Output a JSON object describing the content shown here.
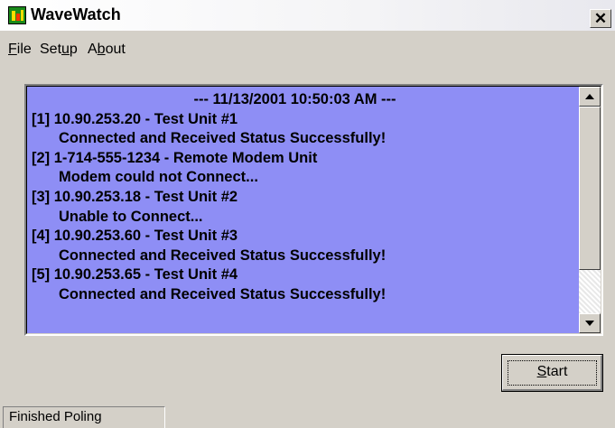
{
  "window": {
    "title": "WaveWatch",
    "icon": "wavewatch-app-icon",
    "close_label": "✕"
  },
  "menu": [
    {
      "label_pre": "",
      "mnemonic": "F",
      "label_post": "ile"
    },
    {
      "label_pre": "Set",
      "mnemonic": "u",
      "label_post": "p"
    },
    {
      "label_pre": "A",
      "mnemonic": "b",
      "label_post": "out"
    }
  ],
  "log": {
    "header": "--- 11/13/2001 10:50:03 AM ---",
    "entries": [
      {
        "unit": "[1] 10.90.253.20 - Test Unit #1",
        "status": "Connected and Received Status Successfully!"
      },
      {
        "unit": "[2] 1-714-555-1234 - Remote Modem Unit",
        "status": "Modem could not Connect..."
      },
      {
        "unit": "[3] 10.90.253.18 - Test Unit #2",
        "status": "Unable to Connect..."
      },
      {
        "unit": "[4] 10.90.253.60 - Test Unit #3",
        "status": "Connected and Received Status Successfully!"
      },
      {
        "unit": "[5] 10.90.253.65 - Test Unit #4",
        "status": "Connected and Received Status Successfully!"
      }
    ],
    "background_color": "#8e8ef5"
  },
  "start_button": {
    "mnemonic": "S",
    "label_post": "tart"
  },
  "statusbar": {
    "text": "Finished Poling"
  }
}
